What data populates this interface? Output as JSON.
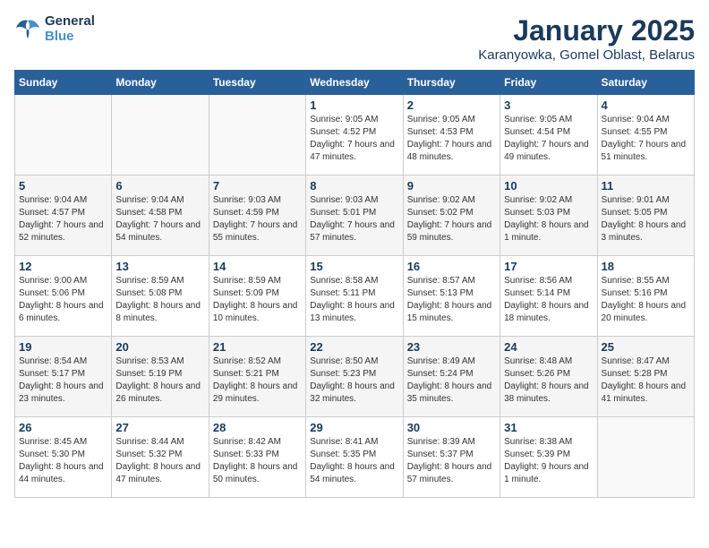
{
  "header": {
    "logo_line1": "General",
    "logo_line2": "Blue",
    "month": "January 2025",
    "location": "Karanyowka, Gomel Oblast, Belarus"
  },
  "weekdays": [
    "Sunday",
    "Monday",
    "Tuesday",
    "Wednesday",
    "Thursday",
    "Friday",
    "Saturday"
  ],
  "weeks": [
    [
      {
        "day": "",
        "info": ""
      },
      {
        "day": "",
        "info": ""
      },
      {
        "day": "",
        "info": ""
      },
      {
        "day": "1",
        "info": "Sunrise: 9:05 AM\nSunset: 4:52 PM\nDaylight: 7 hours and 47 minutes."
      },
      {
        "day": "2",
        "info": "Sunrise: 9:05 AM\nSunset: 4:53 PM\nDaylight: 7 hours and 48 minutes."
      },
      {
        "day": "3",
        "info": "Sunrise: 9:05 AM\nSunset: 4:54 PM\nDaylight: 7 hours and 49 minutes."
      },
      {
        "day": "4",
        "info": "Sunrise: 9:04 AM\nSunset: 4:55 PM\nDaylight: 7 hours and 51 minutes."
      }
    ],
    [
      {
        "day": "5",
        "info": "Sunrise: 9:04 AM\nSunset: 4:57 PM\nDaylight: 7 hours and 52 minutes."
      },
      {
        "day": "6",
        "info": "Sunrise: 9:04 AM\nSunset: 4:58 PM\nDaylight: 7 hours and 54 minutes."
      },
      {
        "day": "7",
        "info": "Sunrise: 9:03 AM\nSunset: 4:59 PM\nDaylight: 7 hours and 55 minutes."
      },
      {
        "day": "8",
        "info": "Sunrise: 9:03 AM\nSunset: 5:01 PM\nDaylight: 7 hours and 57 minutes."
      },
      {
        "day": "9",
        "info": "Sunrise: 9:02 AM\nSunset: 5:02 PM\nDaylight: 7 hours and 59 minutes."
      },
      {
        "day": "10",
        "info": "Sunrise: 9:02 AM\nSunset: 5:03 PM\nDaylight: 8 hours and 1 minute."
      },
      {
        "day": "11",
        "info": "Sunrise: 9:01 AM\nSunset: 5:05 PM\nDaylight: 8 hours and 3 minutes."
      }
    ],
    [
      {
        "day": "12",
        "info": "Sunrise: 9:00 AM\nSunset: 5:06 PM\nDaylight: 8 hours and 6 minutes."
      },
      {
        "day": "13",
        "info": "Sunrise: 8:59 AM\nSunset: 5:08 PM\nDaylight: 8 hours and 8 minutes."
      },
      {
        "day": "14",
        "info": "Sunrise: 8:59 AM\nSunset: 5:09 PM\nDaylight: 8 hours and 10 minutes."
      },
      {
        "day": "15",
        "info": "Sunrise: 8:58 AM\nSunset: 5:11 PM\nDaylight: 8 hours and 13 minutes."
      },
      {
        "day": "16",
        "info": "Sunrise: 8:57 AM\nSunset: 5:13 PM\nDaylight: 8 hours and 15 minutes."
      },
      {
        "day": "17",
        "info": "Sunrise: 8:56 AM\nSunset: 5:14 PM\nDaylight: 8 hours and 18 minutes."
      },
      {
        "day": "18",
        "info": "Sunrise: 8:55 AM\nSunset: 5:16 PM\nDaylight: 8 hours and 20 minutes."
      }
    ],
    [
      {
        "day": "19",
        "info": "Sunrise: 8:54 AM\nSunset: 5:17 PM\nDaylight: 8 hours and 23 minutes."
      },
      {
        "day": "20",
        "info": "Sunrise: 8:53 AM\nSunset: 5:19 PM\nDaylight: 8 hours and 26 minutes."
      },
      {
        "day": "21",
        "info": "Sunrise: 8:52 AM\nSunset: 5:21 PM\nDaylight: 8 hours and 29 minutes."
      },
      {
        "day": "22",
        "info": "Sunrise: 8:50 AM\nSunset: 5:23 PM\nDaylight: 8 hours and 32 minutes."
      },
      {
        "day": "23",
        "info": "Sunrise: 8:49 AM\nSunset: 5:24 PM\nDaylight: 8 hours and 35 minutes."
      },
      {
        "day": "24",
        "info": "Sunrise: 8:48 AM\nSunset: 5:26 PM\nDaylight: 8 hours and 38 minutes."
      },
      {
        "day": "25",
        "info": "Sunrise: 8:47 AM\nSunset: 5:28 PM\nDaylight: 8 hours and 41 minutes."
      }
    ],
    [
      {
        "day": "26",
        "info": "Sunrise: 8:45 AM\nSunset: 5:30 PM\nDaylight: 8 hours and 44 minutes."
      },
      {
        "day": "27",
        "info": "Sunrise: 8:44 AM\nSunset: 5:32 PM\nDaylight: 8 hours and 47 minutes."
      },
      {
        "day": "28",
        "info": "Sunrise: 8:42 AM\nSunset: 5:33 PM\nDaylight: 8 hours and 50 minutes."
      },
      {
        "day": "29",
        "info": "Sunrise: 8:41 AM\nSunset: 5:35 PM\nDaylight: 8 hours and 54 minutes."
      },
      {
        "day": "30",
        "info": "Sunrise: 8:39 AM\nSunset: 5:37 PM\nDaylight: 8 hours and 57 minutes."
      },
      {
        "day": "31",
        "info": "Sunrise: 8:38 AM\nSunset: 5:39 PM\nDaylight: 9 hours and 1 minute."
      },
      {
        "day": "",
        "info": ""
      }
    ]
  ]
}
